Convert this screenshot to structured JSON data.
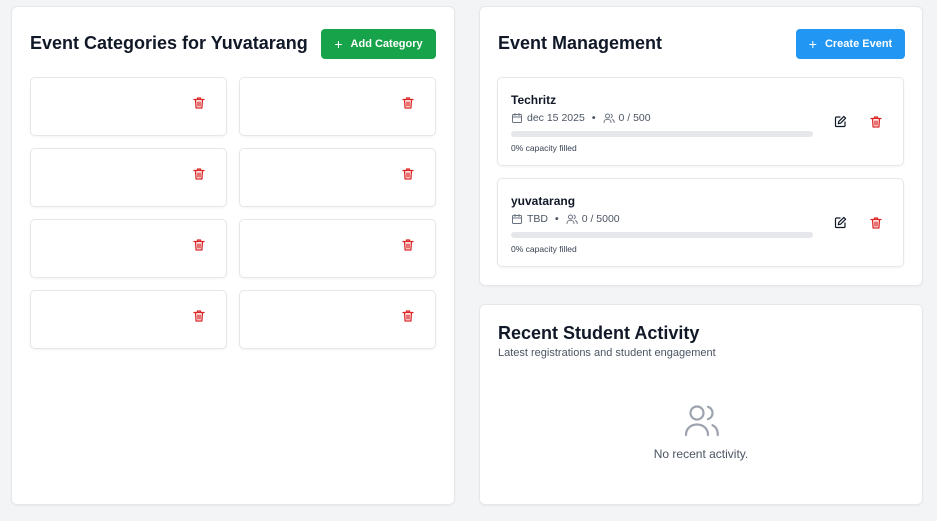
{
  "categories_panel": {
    "title": "Event Categories for Yuvatarang",
    "add_button_label": "Add Category",
    "cards": [
      "",
      "",
      "",
      "",
      "",
      "",
      "",
      ""
    ]
  },
  "events_panel": {
    "title": "Event Management",
    "create_button_label": "Create Event",
    "events": [
      {
        "name": "Techritz",
        "date": "dec 15 2025",
        "capacity": "0 / 500",
        "fill_percent": 0,
        "capacity_text": "0% capacity filled"
      },
      {
        "name": "yuvatarang",
        "date": "TBD",
        "capacity": "0 / 5000",
        "fill_percent": 0,
        "capacity_text": "0% capacity filled"
      }
    ]
  },
  "activity_panel": {
    "title": "Recent Student Activity",
    "subtitle": "Latest registrations and student engagement",
    "empty_text": "No recent activity."
  },
  "colors": {
    "add_button": "#16a34a",
    "create_button": "#2196f3",
    "delete_icon": "#dc2626",
    "page_background": "#f3f4f6"
  },
  "icons": {
    "add": "plus-icon",
    "delete": "trash-icon",
    "edit": "edit-icon",
    "date": "calendar-icon",
    "capacity": "users-icon",
    "empty_state": "users-icon"
  }
}
